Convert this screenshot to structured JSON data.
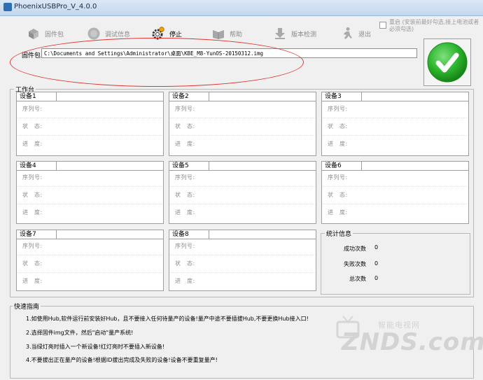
{
  "window": {
    "title": "PhoenixUSBPro_V_4.0.0"
  },
  "toolbar": {
    "items": [
      {
        "label": "固件包",
        "icon": "firmware-package-icon",
        "active": false
      },
      {
        "label": "调试信息",
        "icon": "debug-info-icon",
        "active": false
      },
      {
        "label": "停止",
        "icon": "gear-stop-icon",
        "active": true
      },
      {
        "label": "帮助",
        "icon": "help-book-icon",
        "active": false
      },
      {
        "label": "版本检测",
        "icon": "version-check-icon",
        "active": false
      },
      {
        "label": "退出",
        "icon": "exit-person-icon",
        "active": false
      }
    ],
    "option_checkbox": {
      "label": "重启 (安装前最好勾选,接上电池或者必须勾选)",
      "checked": false
    }
  },
  "firmware": {
    "label": "固件包",
    "path": "C:\\Documents and Settings\\Administrator\\桌面\\KBE_M8-YunOS-20150312.img"
  },
  "start_button": {
    "icon": "green-checkmark-icon",
    "color": "#2db52d"
  },
  "workspace": {
    "title": "工作台",
    "devices": [
      {
        "name": "设备1"
      },
      {
        "name": "设备2"
      },
      {
        "name": "设备3"
      },
      {
        "name": "设备4"
      },
      {
        "name": "设备5"
      },
      {
        "name": "设备6"
      },
      {
        "name": "设备7"
      },
      {
        "name": "设备8"
      }
    ],
    "field_labels": {
      "serial": "序列号:",
      "status": "状　态:",
      "progress": "进　度:"
    }
  },
  "stats": {
    "title": "统计信息",
    "success_label": "成功次数",
    "success_value": "0",
    "fail_label": "失败次数",
    "fail_value": "0",
    "total_label": "总次数",
    "total_value": "0"
  },
  "guide": {
    "title": "快速指南",
    "lines": [
      "1.如使用Hub,软件运行前安装好Hub，且不要接入任何待量产的设备!量产中途不要插拔Hub,不要更换Hub接入口!",
      "2.选择固件img文件，然后\"启动\"量产系统!",
      "3.当绿灯亮时插入一个新设备!红灯亮时不要插入新设备!",
      "4.不要拔出正在量产的设备!根据ID拔出完成及失败的设备!设备不要重复量产!"
    ]
  },
  "watermark": {
    "text": "ZNDS.com",
    "subtext": "智能电视网"
  },
  "colors": {
    "highlight_ellipse": "#e0342f",
    "check_green": "#2db52d",
    "titlebar": "#c3d7ee"
  }
}
